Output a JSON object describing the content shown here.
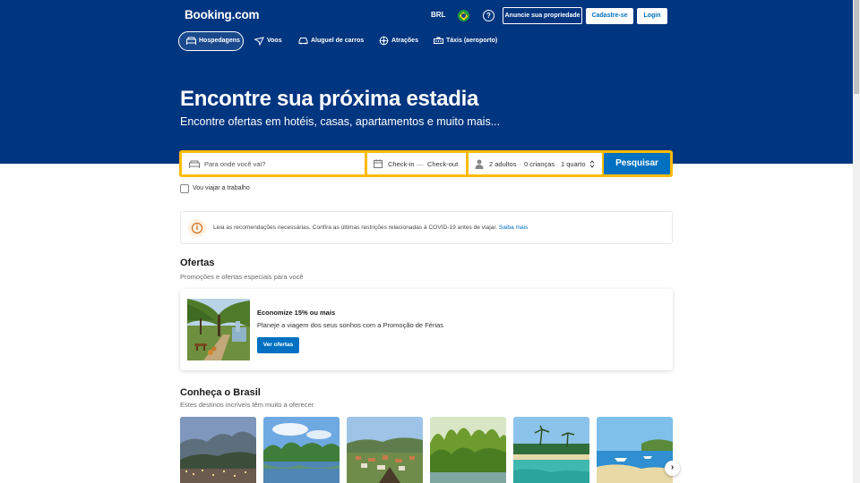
{
  "header": {
    "logo": "Booking.com",
    "currency": "BRL",
    "help_glyph": "?",
    "list_property_label": "Anuncie sua propriedade",
    "register_label": "Cadastre-se",
    "login_label": "Login"
  },
  "nav": {
    "tabs": [
      {
        "label": "Hospedagens",
        "icon": "bed-icon",
        "active": true
      },
      {
        "label": "Voos",
        "icon": "plane-icon",
        "active": false
      },
      {
        "label": "Aluguel de carros",
        "icon": "car-icon",
        "active": false
      },
      {
        "label": "Atrações",
        "icon": "attractions-icon",
        "active": false
      },
      {
        "label": "Táxis (aeroporto)",
        "icon": "taxi-icon",
        "active": false
      }
    ]
  },
  "hero": {
    "title": "Encontre sua próxima estadia",
    "subtitle": "Encontre ofertas em hotéis, casas, apartamentos e muito mais..."
  },
  "search": {
    "destination_placeholder": "Para onde você vai?",
    "checkin_label": "Check-in",
    "date_separator": "—",
    "checkout_label": "Check-out",
    "guests_adults": "2 adultos",
    "guests_children": "0 crianças",
    "guests_rooms": "1 quarto",
    "guest_separator": "·",
    "button_label": "Pesquisar"
  },
  "work_trip": {
    "label": "Vou viajar a trabalho",
    "checked": false
  },
  "alert": {
    "icon_glyph": "i",
    "text": "Leia as recomendações necessárias. Confira as últimas restrições relacionadas à COVID-19 antes de viajar. ",
    "link": "Saiba mais"
  },
  "offers": {
    "title": "Ofertas",
    "subtitle": "Promoções e ofertas especiais para você",
    "card": {
      "heading": "Economize 15% ou mais",
      "description": "Planeje a viagem dos seus sonhos com a Promoção de Férias",
      "button_label": "Ver ofertas"
    }
  },
  "brazil": {
    "title": "Conheça o Brasil",
    "subtitle": "Estes destinos incríveis têm muito a oferecer",
    "next_glyph": "›"
  },
  "colors": {
    "brand_blue": "#003580",
    "action_blue": "#0071c2",
    "search_yellow": "#febb02"
  }
}
